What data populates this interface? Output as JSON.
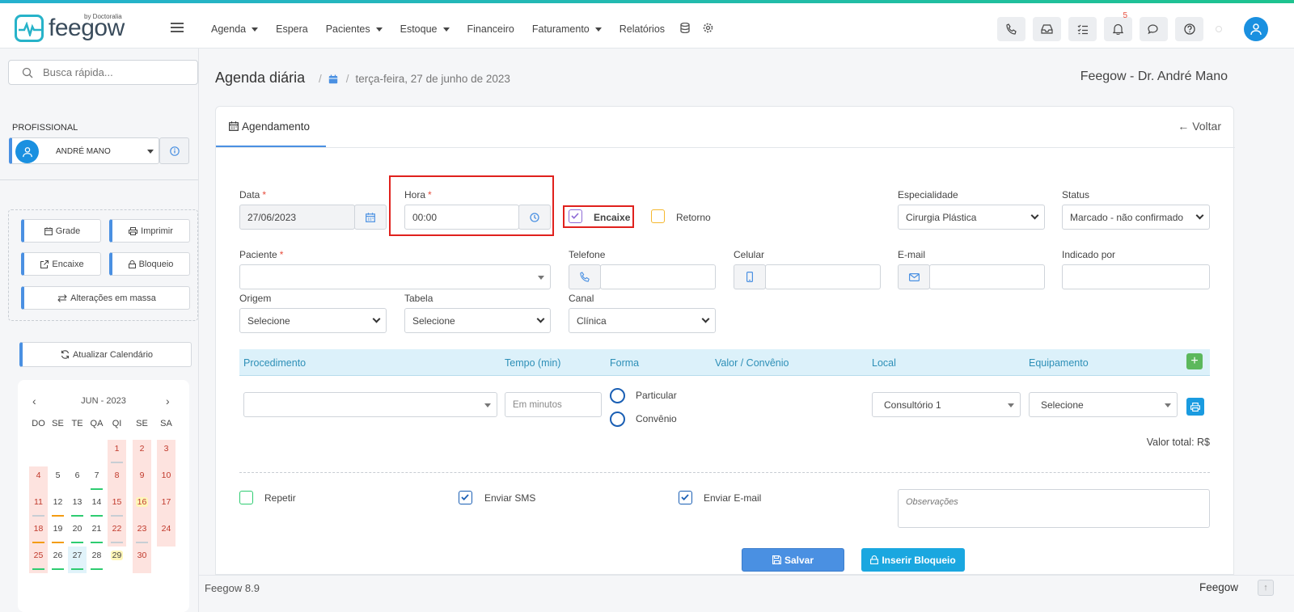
{
  "header": {
    "logo_text": "feegow",
    "logo_by": "by Doctoralia",
    "nav": [
      {
        "label": "Agenda",
        "dropdown": true
      },
      {
        "label": "Espera",
        "dropdown": false
      },
      {
        "label": "Pacientes",
        "dropdown": true
      },
      {
        "label": "Estoque",
        "dropdown": true
      },
      {
        "label": "Financeiro",
        "dropdown": false
      },
      {
        "label": "Faturamento",
        "dropdown": true
      },
      {
        "label": "Relatórios",
        "dropdown": false
      }
    ],
    "notification_count": "5"
  },
  "sidebar": {
    "search_placeholder": "Busca rápida...",
    "professional_label": "PROFISSIONAL",
    "professional_name": "ANDRÉ MANO",
    "buttons": {
      "grade": "Grade",
      "imprimir": "Imprimir",
      "encaixe": "Encaixe",
      "bloqueio": "Bloqueio",
      "alteracoes": "Alterações em massa"
    },
    "refresh_label": "Atualizar Calendário",
    "calendar": {
      "month": "JUN - 2023",
      "weekdays": [
        "DO",
        "SE",
        "TE",
        "QA",
        "QI",
        "SE",
        "SA"
      ],
      "weeks": [
        [
          null,
          null,
          null,
          null,
          {
            "d": "1",
            "red": true,
            "bar": "gr"
          },
          {
            "d": "2",
            "red": true
          },
          {
            "d": "3",
            "red": true
          }
        ],
        [
          {
            "d": "4",
            "red": true
          },
          {
            "d": "5"
          },
          {
            "d": "6"
          },
          {
            "d": "7",
            "bar": "g"
          },
          {
            "d": "8",
            "red": true
          },
          {
            "d": "9",
            "red": true
          },
          {
            "d": "10",
            "red": true
          }
        ],
        [
          {
            "d": "11",
            "red": true,
            "bar": "gr"
          },
          {
            "d": "12",
            "bar": "o"
          },
          {
            "d": "13",
            "bar": "g"
          },
          {
            "d": "14",
            "bar": "g"
          },
          {
            "d": "15",
            "red": true,
            "bar": "gr"
          },
          {
            "d": "16",
            "red": true,
            "yel": true
          },
          {
            "d": "17",
            "red": true
          }
        ],
        [
          {
            "d": "18",
            "red": true,
            "bar": "o"
          },
          {
            "d": "19",
            "bar": "o"
          },
          {
            "d": "20",
            "bar": "g"
          },
          {
            "d": "21",
            "bar": "g"
          },
          {
            "d": "22",
            "red": true,
            "bar": "gr"
          },
          {
            "d": "23",
            "red": true,
            "bar": "gr"
          },
          {
            "d": "24",
            "red": true
          }
        ],
        [
          {
            "d": "25",
            "red": true,
            "bar": "g"
          },
          {
            "d": "26",
            "bar": "g"
          },
          {
            "d": "27",
            "blue": true,
            "bar": "g"
          },
          {
            "d": "28",
            "bar": "g"
          },
          {
            "d": "29",
            "yel": true
          },
          {
            "d": "30",
            "red": true
          },
          null
        ]
      ]
    }
  },
  "main": {
    "title": "Agenda diária",
    "breadcrumb_date": "terça-feira, 27 de junho de 2023",
    "clinic_name": "Feegow - Dr. André Mano",
    "tab_label": "Agendamento",
    "back_label": "Voltar"
  },
  "form": {
    "data_label": "Data",
    "data_value": "27/06/2023",
    "hora_label": "Hora",
    "hora_value": "00:00",
    "encaixe_label": "Encaixe",
    "retorno_label": "Retorno",
    "especialidade_label": "Especialidade",
    "especialidade_value": "Cirurgia Plástica",
    "status_label": "Status",
    "status_value": "Marcado - não confirmado",
    "paciente_label": "Paciente",
    "telefone_label": "Telefone",
    "celular_label": "Celular",
    "email_label": "E-mail",
    "indicado_label": "Indicado por",
    "origem_label": "Origem",
    "origem_value": "Selecione",
    "tabela_label": "Tabela",
    "tabela_value": "Selecione",
    "canal_label": "Canal",
    "canal_value": "Clínica"
  },
  "procedures": {
    "headers": {
      "procedimento": "Procedimento",
      "tempo": "Tempo (min)",
      "forma": "Forma",
      "valor": "Valor / Convênio",
      "local": "Local",
      "equipamento": "Equipamento"
    },
    "tempo_placeholder": "Em minutos",
    "forma_particular": "Particular",
    "forma_convenio": "Convênio",
    "local_value": "Consultório 1",
    "equipamento_value": "Selecione",
    "total_label": "Valor total: R$"
  },
  "options": {
    "repetir": "Repetir",
    "enviar_sms": "Enviar SMS",
    "enviar_email": "Enviar E-mail",
    "obs_placeholder": "Observações"
  },
  "actions": {
    "salvar": "Salvar",
    "inserir_bloqueio": "Inserir Bloqueio"
  },
  "footer": {
    "version": "Feegow 8.9",
    "brand": "Feegow"
  },
  "colors": {
    "accent": "#4a90e2",
    "highlight": "#e0211d",
    "encaixe_check": "#8e6bd6",
    "retorno_check": "#f5b82e",
    "repetir_check": "#2ecc71"
  }
}
